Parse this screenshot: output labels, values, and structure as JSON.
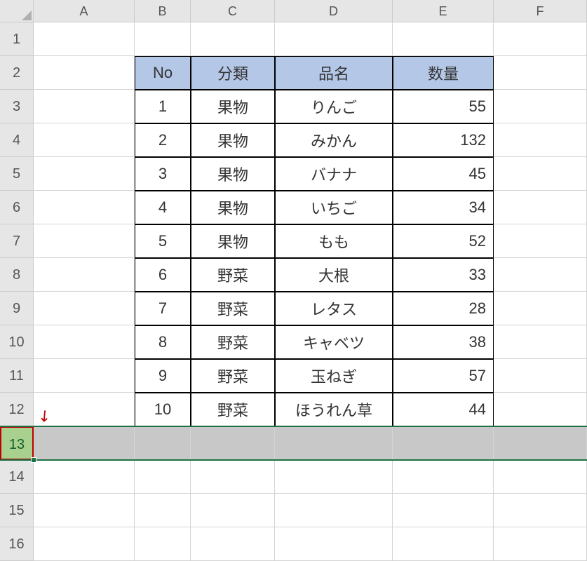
{
  "columns": [
    "A",
    "B",
    "C",
    "D",
    "E",
    "F"
  ],
  "rows": [
    "1",
    "2",
    "3",
    "4",
    "5",
    "6",
    "7",
    "8",
    "9",
    "10",
    "11",
    "12",
    "13",
    "14",
    "15",
    "16"
  ],
  "headers": {
    "no": "No",
    "cat": "分類",
    "name": "品名",
    "qty": "数量"
  },
  "data": [
    {
      "no": "1",
      "cat": "果物",
      "name": "りんご",
      "qty": "55"
    },
    {
      "no": "2",
      "cat": "果物",
      "name": "みかん",
      "qty": "132"
    },
    {
      "no": "3",
      "cat": "果物",
      "name": "バナナ",
      "qty": "45"
    },
    {
      "no": "4",
      "cat": "果物",
      "name": "いちご",
      "qty": "34"
    },
    {
      "no": "5",
      "cat": "果物",
      "name": "もも",
      "qty": "52"
    },
    {
      "no": "6",
      "cat": "野菜",
      "name": "大根",
      "qty": "33"
    },
    {
      "no": "7",
      "cat": "野菜",
      "name": "レタス",
      "qty": "28"
    },
    {
      "no": "8",
      "cat": "野菜",
      "name": "キャベツ",
      "qty": "38"
    },
    {
      "no": "9",
      "cat": "野菜",
      "name": "玉ねぎ",
      "qty": "57"
    },
    {
      "no": "10",
      "cat": "野菜",
      "name": "ほうれん草",
      "qty": "44"
    }
  ],
  "selected_row_index": 12,
  "arrow_glyph": "↙"
}
